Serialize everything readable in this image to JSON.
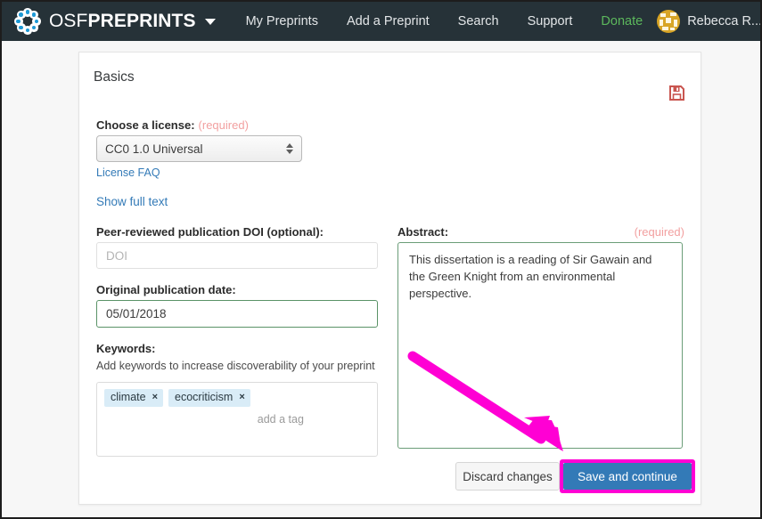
{
  "navbar": {
    "logo_icon": "osf-flower-logo",
    "brand_prefix": "OSF",
    "brand_suffix": "PREPRINTS",
    "brand_caret_icon": "caret-down-icon",
    "links": [
      {
        "label": "My Preprints",
        "name": "nav-my-preprints"
      },
      {
        "label": "Add a Preprint",
        "name": "nav-add-a-preprint"
      },
      {
        "label": "Search",
        "name": "nav-search"
      },
      {
        "label": "Support",
        "name": "nav-support"
      },
      {
        "label": "Donate",
        "name": "nav-donate",
        "color": "#5cb85c"
      }
    ],
    "user": {
      "name": "Rebecca R...",
      "avatar_icon": "user-avatar-identicon",
      "caret_icon": "caret-down-icon"
    },
    "background": "#263238"
  },
  "panel": {
    "title": "Basics",
    "save_icon": "floppy-disk-save-icon",
    "save_icon_color": "#c9554f"
  },
  "license": {
    "label": "Choose a license:",
    "required_text": "(required)",
    "selected_value": "CC0 1.0 Universal",
    "options": [
      "CC0 1.0 Universal"
    ],
    "faq_link": "License FAQ",
    "show_full_text_link": "Show full text"
  },
  "doi": {
    "label": "Peer-reviewed publication DOI (optional):",
    "value": "",
    "placeholder": "DOI"
  },
  "publication_date": {
    "label": "Original publication date:",
    "value": "05/01/2018",
    "border_color": "#5a9367"
  },
  "keywords": {
    "label": "Keywords:",
    "helper": "Add keywords to increase discoverability of your preprint",
    "tags": [
      {
        "text": "climate",
        "remove_icon": "×"
      },
      {
        "text": "ecocriticism",
        "remove_icon": "×"
      }
    ],
    "input_placeholder": "add a tag",
    "tag_background": "#d9ecf7"
  },
  "abstract": {
    "label": "Abstract:",
    "required_text": "(required)",
    "value": "This dissertation is a reading of Sir Gawain and the Green Knight from an environmental perspective.",
    "border_color": "#6b9d78"
  },
  "actions": {
    "discard_label": "Discard changes",
    "save_label": "Save and continue",
    "save_color": "#337ab7",
    "highlight_color": "#ff00d4"
  },
  "annotation": {
    "arrow_icon": "magenta-pointer-arrow",
    "arrow_color": "#ff00d4",
    "points_to": "Save and continue"
  }
}
